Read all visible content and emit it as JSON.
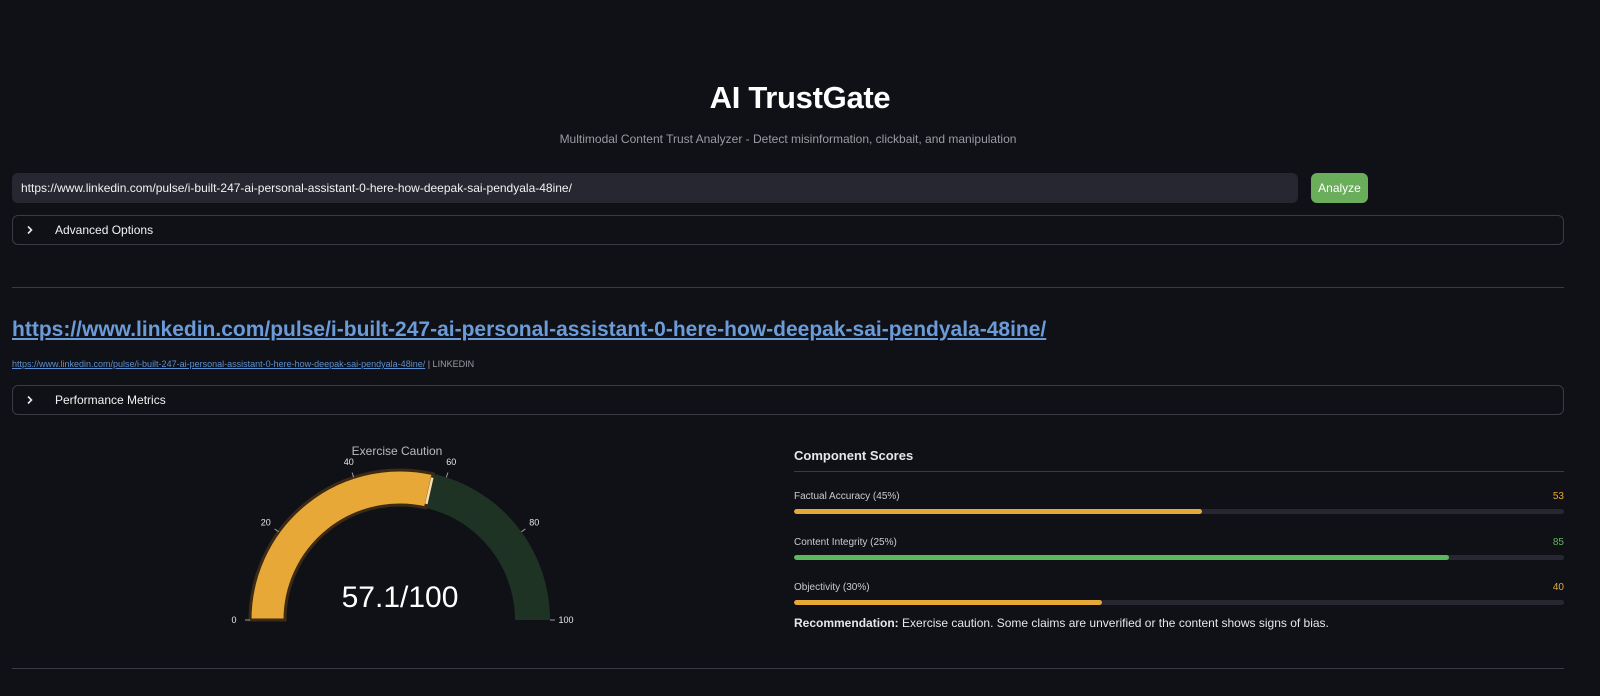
{
  "header": {
    "title": "AI TrustGate",
    "subtitle": "Multimodal Content Trust Analyzer - Detect misinformation, clickbait, and manipulation"
  },
  "search": {
    "value": "https://www.linkedin.com/pulse/i-built-247-ai-personal-assistant-0-here-how-deepak-sai-pendyala-48ine/",
    "button_label": "Analyze"
  },
  "advanced": {
    "label": "Advanced Options",
    "icon": "chevron-right-icon"
  },
  "result": {
    "title": "https://www.linkedin.com/pulse/i-built-247-ai-personal-assistant-0-here-how-deepak-sai-pendyala-48ine/",
    "source_link": "https://www.linkedin.com/pulse/i-built-247-ai-personal-assistant-0-here-how-deepak-sai-pendyala-48ine/",
    "source_suffix": " | LINKEDIN"
  },
  "performance": {
    "label": "Performance Metrics",
    "icon": "chevron-right-icon"
  },
  "gauge": {
    "title": "Exercise Caution",
    "score_text": "57.1/100",
    "value": 57.1,
    "min": 0,
    "max": 100,
    "ticks": [
      "0",
      "20",
      "40",
      "60",
      "80",
      "100"
    ],
    "fill_color": "#e8a838",
    "background_color": "#1f3324",
    "edge_color": "#3b2a14"
  },
  "components": {
    "title": "Component Scores",
    "items": [
      {
        "label": "Factual Accuracy (45%)",
        "value": 53,
        "value_text": "53",
        "color": "#e8a838"
      },
      {
        "label": "Content Integrity (25%)",
        "value": 85,
        "value_text": "85",
        "color": "#5cb85c"
      },
      {
        "label": "Objectivity (30%)",
        "value": 40,
        "value_text": "40",
        "color": "#e8a838"
      }
    ]
  },
  "recommendation": {
    "label": "Recommendation:",
    "text": " Exercise caution. Some claims are unverified or the content shows signs of bias."
  }
}
